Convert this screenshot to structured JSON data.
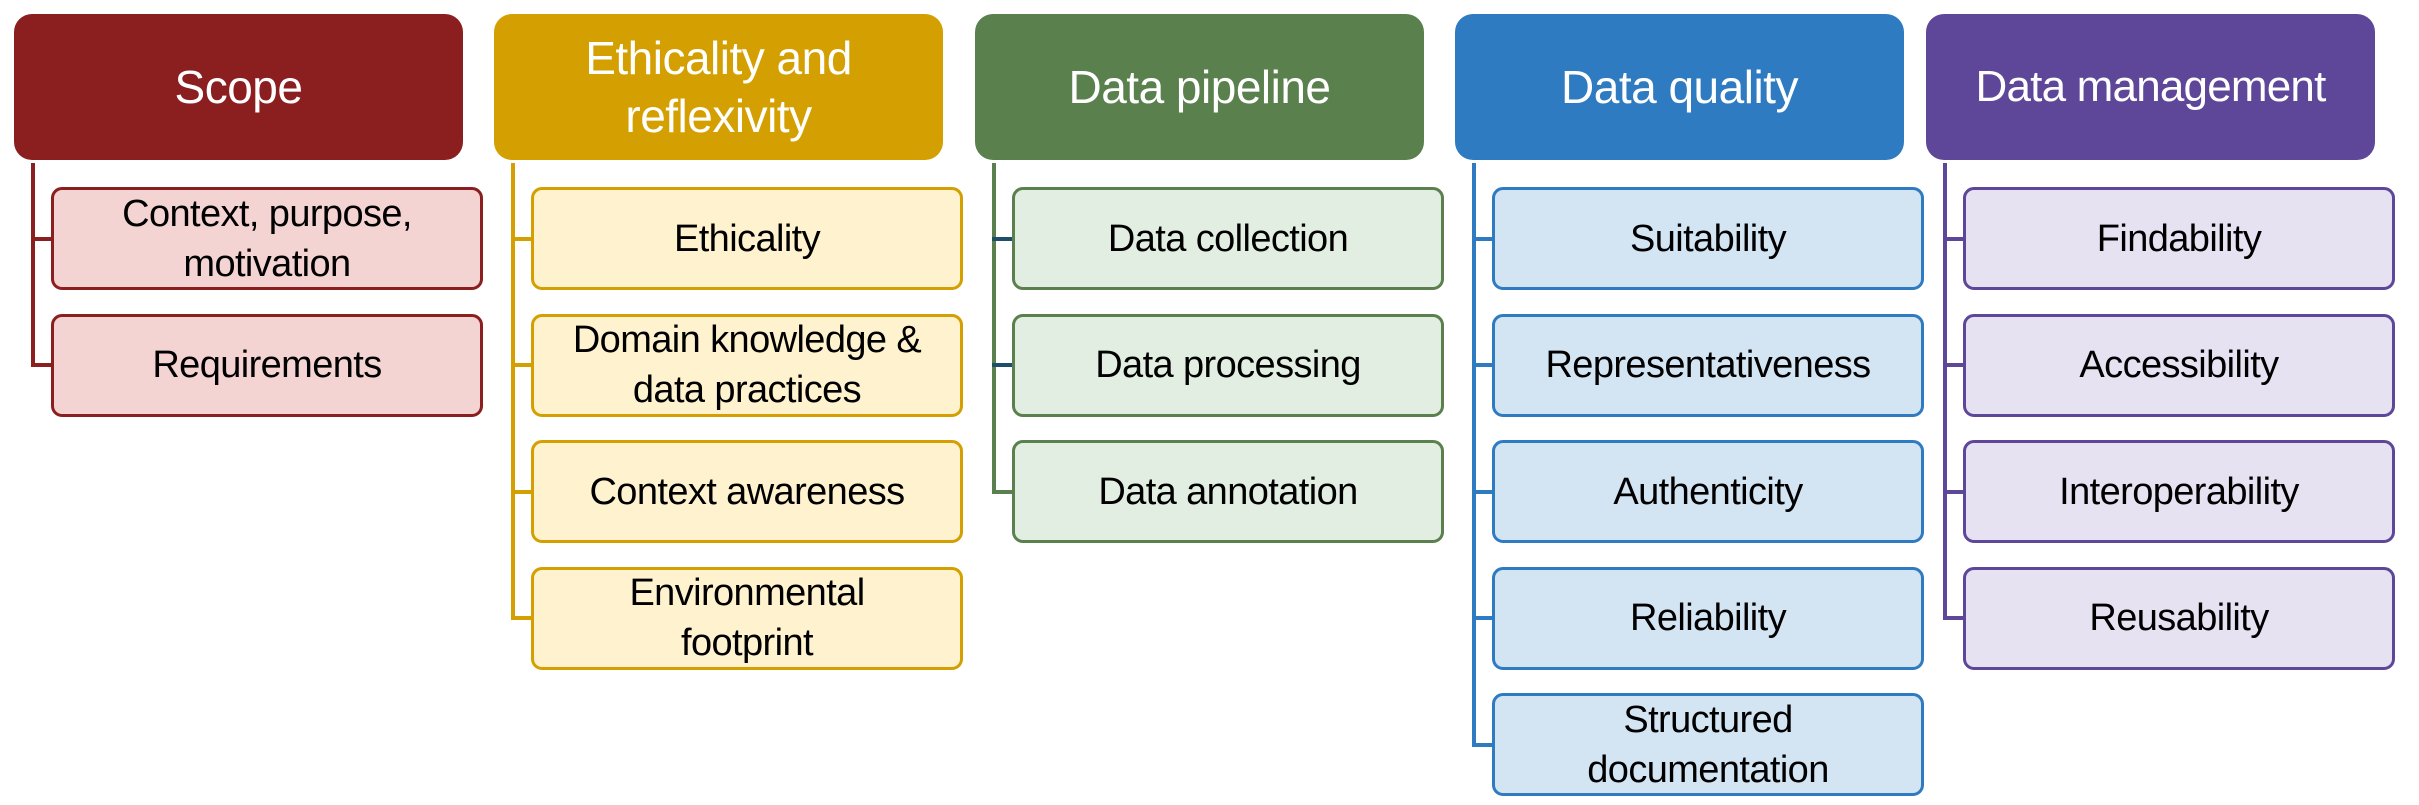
{
  "diagram": {
    "categories": [
      {
        "title": "Scope",
        "colors": {
          "header": "#8B1E1F",
          "fill": "#F4D3D3",
          "border": "#8B1E1F",
          "line": "#8B1E1F"
        },
        "items": [
          {
            "label": "Context, purpose, motivation"
          },
          {
            "label": "Requirements"
          }
        ]
      },
      {
        "title": "Ethicality and reflexivity",
        "colors": {
          "header": "#D49F00",
          "fill": "#FFF2CE",
          "border": "#D49F00",
          "line": "#D49F00"
        },
        "items": [
          {
            "label": "Ethicality"
          },
          {
            "label": "Domain knowledge & data practices"
          },
          {
            "label": "Context awareness"
          },
          {
            "label": "Environmental footprint"
          }
        ]
      },
      {
        "title": "Data pipeline",
        "colors": {
          "header": "#5A814D",
          "fill": "#E3EEE2",
          "border": "#5A814D",
          "line": "#5A814D",
          "tick_alt": "#1F4E6B"
        },
        "items": [
          {
            "label": "Data collection",
            "tick": "alt"
          },
          {
            "label": "Data processing",
            "tick": "alt"
          },
          {
            "label": "Data annotation"
          }
        ]
      },
      {
        "title": "Data quality",
        "colors": {
          "header": "#2F7BC1",
          "fill": "#D3E4F3",
          "border": "#2F7BC1",
          "line": "#2F7BC1"
        },
        "items": [
          {
            "label": "Suitability"
          },
          {
            "label": "Representativeness"
          },
          {
            "label": "Authenticity"
          },
          {
            "label": "Reliability"
          },
          {
            "label": "Structured documentation"
          }
        ]
      },
      {
        "title": "Data management",
        "colors": {
          "header": "#5E4698",
          "fill": "#E6E2F2",
          "border": "#5E4698",
          "line": "#5E4698"
        },
        "items": [
          {
            "label": "Findability"
          },
          {
            "label": "Accessibility"
          },
          {
            "label": "Interoperability"
          },
          {
            "label": "Reusability"
          }
        ]
      }
    ]
  }
}
